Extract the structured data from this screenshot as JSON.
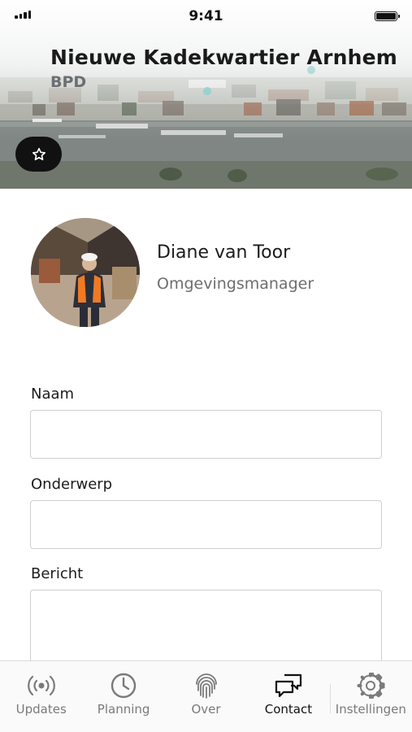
{
  "status_bar": {
    "time": "9:41"
  },
  "project": {
    "title": "Nieuwe Kadekwartier Arnhem",
    "organization": "BPD"
  },
  "contact": {
    "name": "Diane van Toor",
    "role": "Omgevingsmanager"
  },
  "form": {
    "fields": [
      {
        "label": "Naam",
        "value": ""
      },
      {
        "label": "Onderwerp",
        "value": ""
      },
      {
        "label": "Bericht",
        "value": ""
      }
    ]
  },
  "tabbar": {
    "active": "Contact",
    "tabs": [
      {
        "label": "Updates",
        "icon": "broadcast-icon"
      },
      {
        "label": "Planning",
        "icon": "clock-icon"
      },
      {
        "label": "Over",
        "icon": "fingerprint-icon"
      },
      {
        "label": "Contact",
        "icon": "chat-bubbles-icon"
      },
      {
        "label": "Instellingen",
        "icon": "gear-icon"
      }
    ]
  },
  "colors": {
    "accent": "#111111",
    "inactive": "#7a7a7a",
    "border": "#cfcfcf"
  }
}
